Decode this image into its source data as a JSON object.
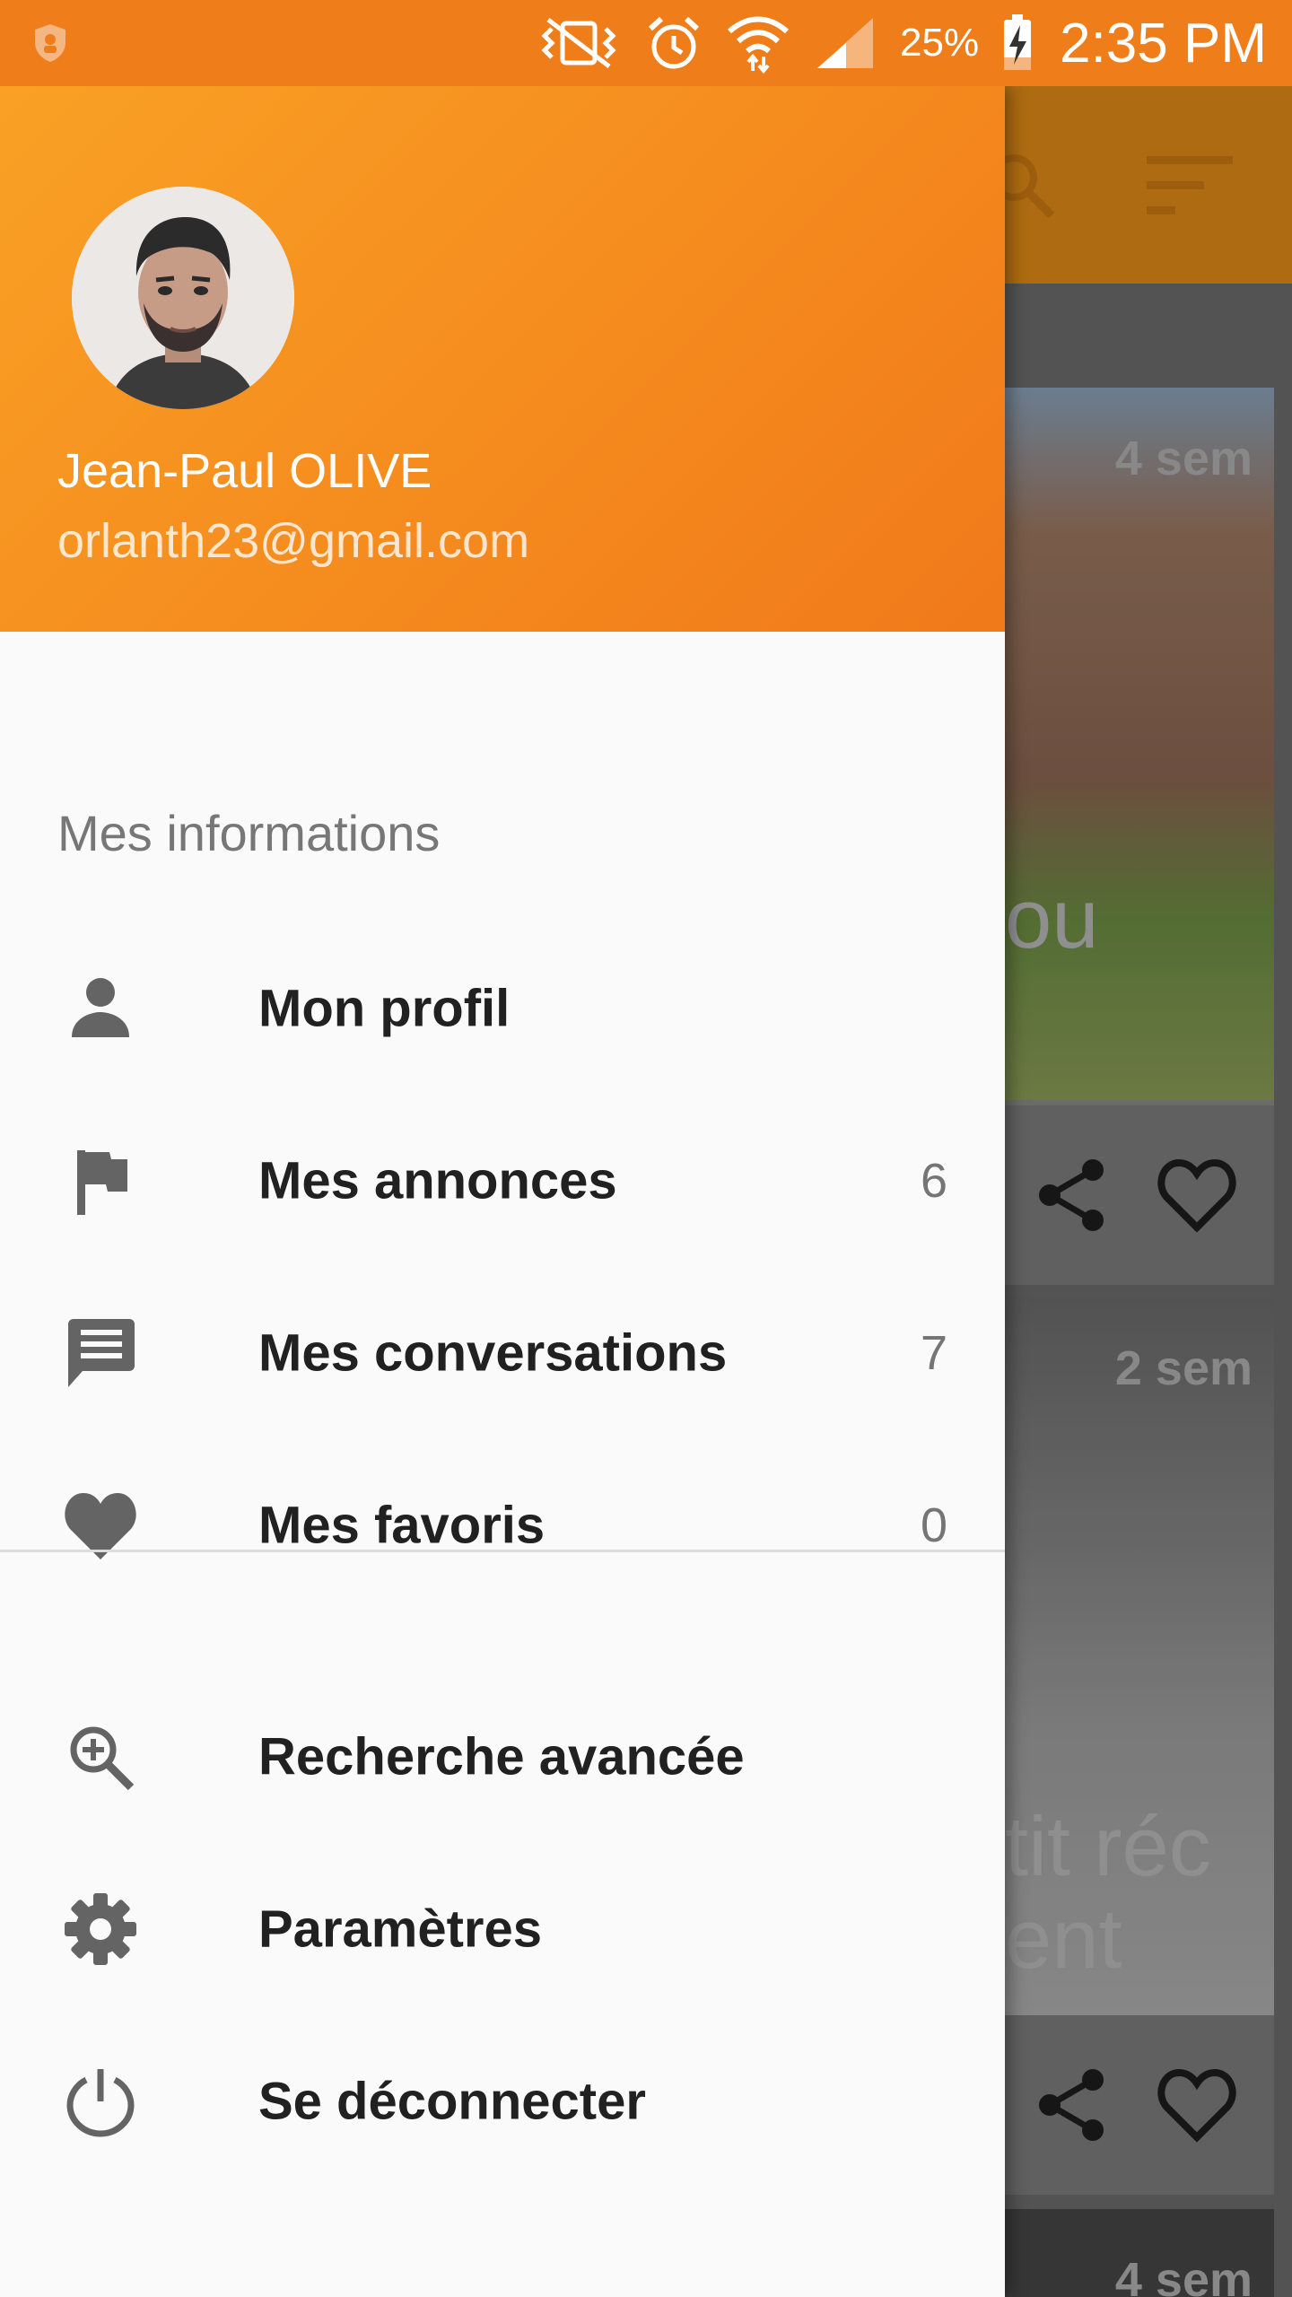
{
  "status_bar": {
    "battery_percent": "25%",
    "time": "2:35 PM"
  },
  "drawer": {
    "header": {
      "user_name": "Jean-Paul OLIVE",
      "user_email": "orlanth23@gmail.com"
    },
    "section_title": "Mes informations",
    "items": [
      {
        "label": "Mon profil",
        "count": "",
        "icon": "person-icon"
      },
      {
        "label": "Mes annonces",
        "count": "6",
        "icon": "flag-icon"
      },
      {
        "label": "Mes conversations",
        "count": "7",
        "icon": "chat-icon"
      },
      {
        "label": "Mes favoris",
        "count": "0",
        "icon": "heart-icon"
      }
    ],
    "secondary_items": [
      {
        "label": "Recherche avancée",
        "icon": "zoom-in-icon"
      },
      {
        "label": "Paramètres",
        "icon": "gear-icon"
      },
      {
        "label": "Se déconnecter",
        "icon": "power-icon"
      }
    ]
  },
  "background_feed": {
    "cards": [
      {
        "time": "4 sem",
        "title_peek": "ou"
      },
      {
        "time": "2 sem",
        "title_peek": "tit réc\nent"
      },
      {
        "time": "4 sem"
      }
    ]
  },
  "colors": {
    "status_bar": "#ef7d1a",
    "header_start": "#f9a125",
    "header_end": "#f0791a",
    "drawer_bg": "#fafafa",
    "text_primary": "#212121",
    "text_secondary": "#757575"
  }
}
